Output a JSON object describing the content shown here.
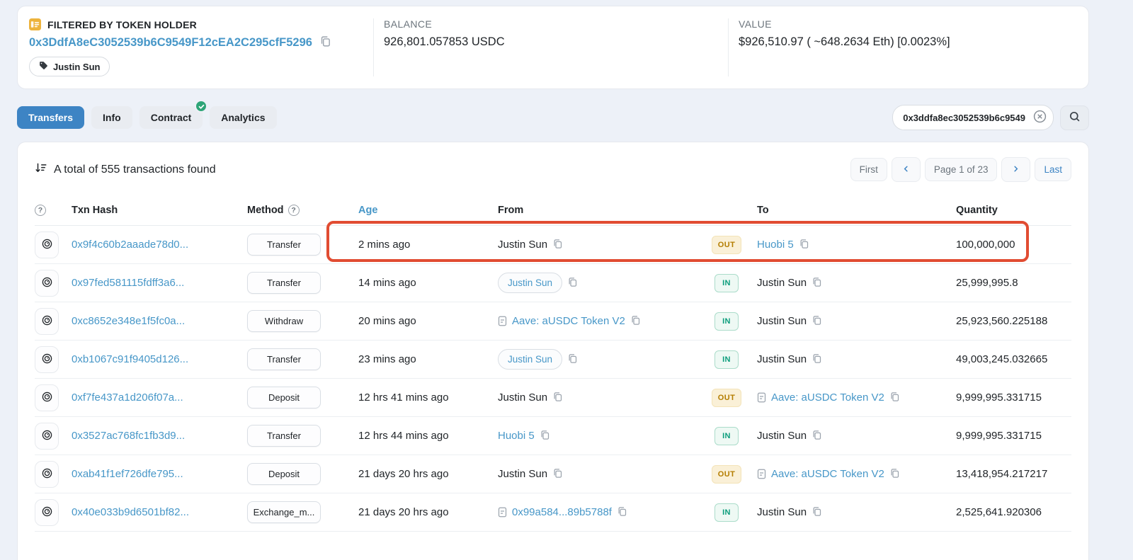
{
  "holder": {
    "title": "FILTERED BY TOKEN HOLDER",
    "address": "0x3DdfA8eC3052539b6C9549F12cEA2C295cfF5296",
    "tag": "Justin Sun",
    "balance_label": "BALANCE",
    "balance_value": "926,801.057853 USDC",
    "value_label": "VALUE",
    "value_value": "$926,510.97 ( ~648.2634 Eth) [0.0023%]"
  },
  "tabs": [
    {
      "label": "Transfers",
      "active": true,
      "verified_badge": false
    },
    {
      "label": "Info",
      "active": false,
      "verified_badge": false
    },
    {
      "label": "Contract",
      "active": false,
      "verified_badge": true
    },
    {
      "label": "Analytics",
      "active": false,
      "verified_badge": false
    }
  ],
  "search": {
    "filter_value": "0x3ddfa8ec3052539b6c9549"
  },
  "table": {
    "summary": "A total of 555 transactions found",
    "pagination": {
      "first_label": "First",
      "page_label": "Page 1 of 23",
      "last_label": "Last"
    },
    "columns": {
      "hash": "Txn Hash",
      "method": "Method",
      "age": "Age",
      "from": "From",
      "to": "To",
      "quantity": "Quantity"
    },
    "rows": [
      {
        "hash": "0x9f4c60b2aaade78d0...",
        "method": "Transfer",
        "age": "2 mins ago",
        "from": {
          "text": "Justin Sun",
          "style": "plain",
          "contract_icon": false
        },
        "direction": "OUT",
        "to": {
          "text": "Huobi 5",
          "style": "link",
          "contract_icon": false
        },
        "quantity": "100,000,000",
        "highlighted": true
      },
      {
        "hash": "0x97fed581115fdff3a6...",
        "method": "Transfer",
        "age": "14 mins ago",
        "from": {
          "text": "Justin Sun",
          "style": "pill",
          "contract_icon": false
        },
        "direction": "IN",
        "to": {
          "text": "Justin Sun",
          "style": "plain",
          "contract_icon": false
        },
        "quantity": "25,999,995.8",
        "highlighted": false
      },
      {
        "hash": "0xc8652e348e1f5fc0a...",
        "method": "Withdraw",
        "age": "20 mins ago",
        "from": {
          "text": "Aave: aUSDC Token V2",
          "style": "link",
          "contract_icon": true
        },
        "direction": "IN",
        "to": {
          "text": "Justin Sun",
          "style": "plain",
          "contract_icon": false
        },
        "quantity": "25,923,560.225188",
        "highlighted": false
      },
      {
        "hash": "0xb1067c91f9405d126...",
        "method": "Transfer",
        "age": "23 mins ago",
        "from": {
          "text": "Justin Sun",
          "style": "pill",
          "contract_icon": false
        },
        "direction": "IN",
        "to": {
          "text": "Justin Sun",
          "style": "plain",
          "contract_icon": false
        },
        "quantity": "49,003,245.032665",
        "highlighted": false
      },
      {
        "hash": "0xf7fe437a1d206f07a...",
        "method": "Deposit",
        "age": "12 hrs 41 mins ago",
        "from": {
          "text": "Justin Sun",
          "style": "plain",
          "contract_icon": false
        },
        "direction": "OUT",
        "to": {
          "text": "Aave: aUSDC Token V2",
          "style": "link",
          "contract_icon": true
        },
        "quantity": "9,999,995.331715",
        "highlighted": false
      },
      {
        "hash": "0x3527ac768fc1fb3d9...",
        "method": "Transfer",
        "age": "12 hrs 44 mins ago",
        "from": {
          "text": "Huobi 5",
          "style": "link",
          "contract_icon": false
        },
        "direction": "IN",
        "to": {
          "text": "Justin Sun",
          "style": "plain",
          "contract_icon": false
        },
        "quantity": "9,999,995.331715",
        "highlighted": false
      },
      {
        "hash": "0xab41f1ef726dfe795...",
        "method": "Deposit",
        "age": "21 days 20 hrs ago",
        "from": {
          "text": "Justin Sun",
          "style": "plain",
          "contract_icon": false
        },
        "direction": "OUT",
        "to": {
          "text": "Aave: aUSDC Token V2",
          "style": "link",
          "contract_icon": true
        },
        "quantity": "13,418,954.217217",
        "highlighted": false
      },
      {
        "hash": "0x40e033b9d6501bf82...",
        "method": "Exchange_m...",
        "age": "21 days 20 hrs ago",
        "from": {
          "text": "0x99a584...89b5788f",
          "style": "link",
          "contract_icon": true
        },
        "direction": "IN",
        "to": {
          "text": "Justin Sun",
          "style": "plain",
          "contract_icon": false
        },
        "quantity": "2,525,641.920306",
        "highlighted": false
      }
    ]
  },
  "colors": {
    "link_blue": "#4797c8",
    "active_tab_blue": "#3d84c4",
    "out_badge_text": "#b47d00",
    "out_badge_bg": "#faf0d7",
    "in_badge_text": "#0b9d7c",
    "in_badge_bg": "#eef9f4",
    "highlight_red": "#e14c32",
    "holder_icon_amber": "#edb33c",
    "verified_green": "#2ea578"
  }
}
